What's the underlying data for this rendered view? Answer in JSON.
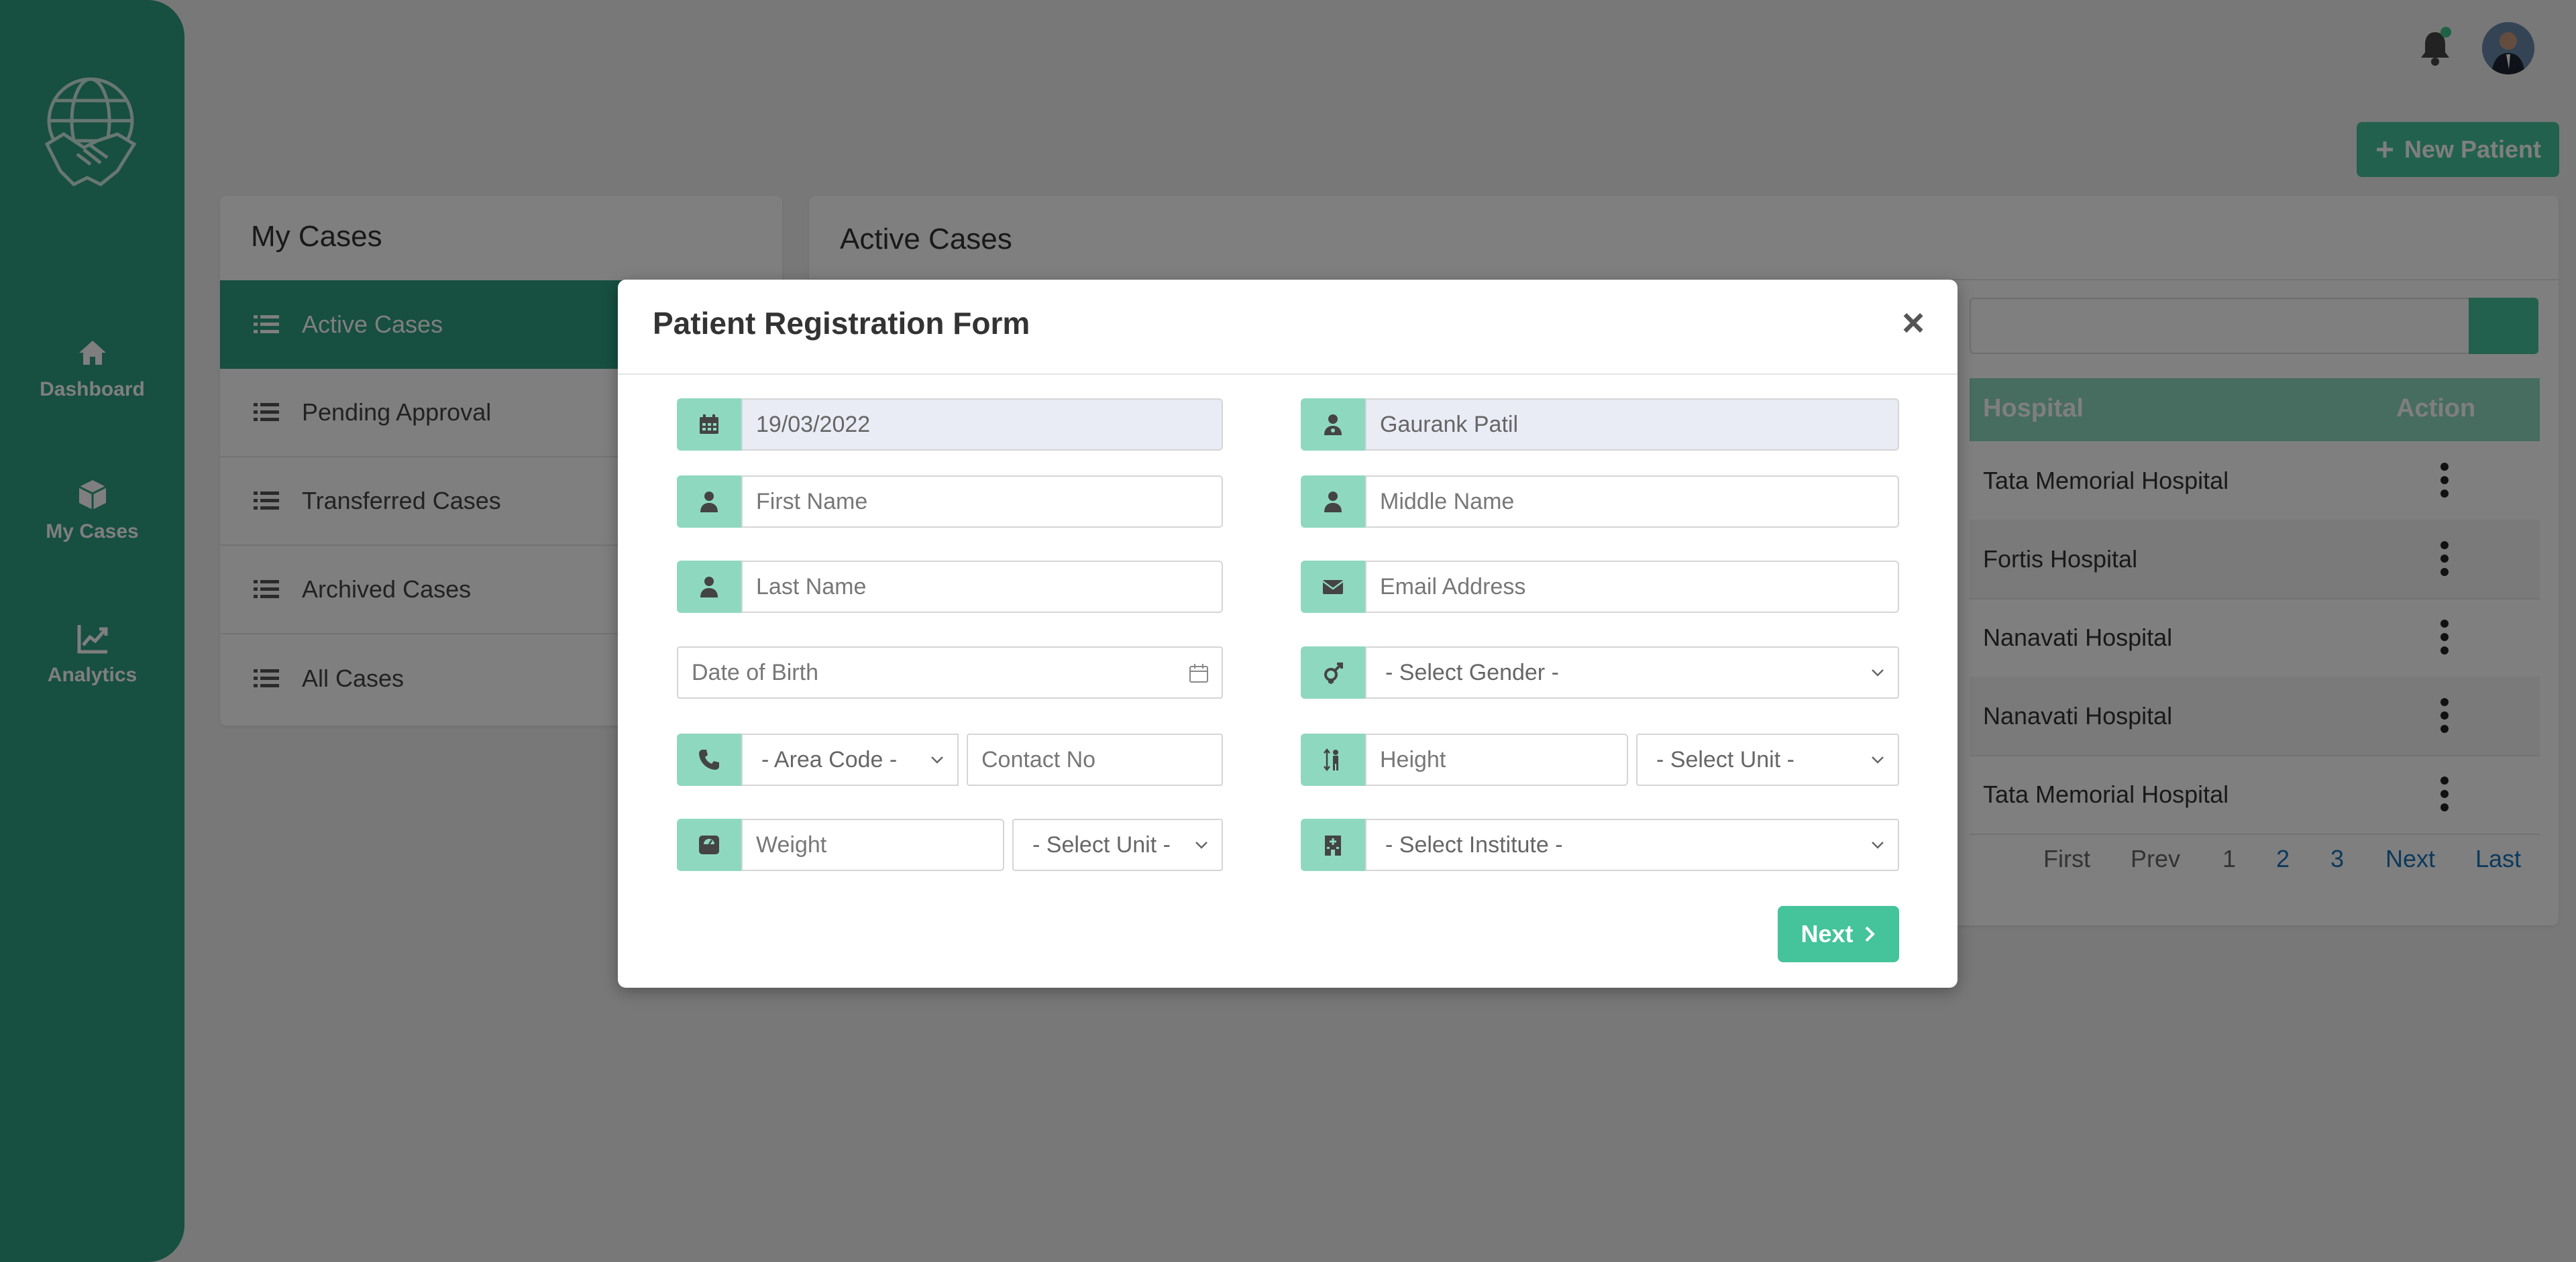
{
  "colors": {
    "brand": "#2e9e80",
    "accent": "#45c39a",
    "addon": "#8fd8c0",
    "link": "#1a73b8"
  },
  "sidebar": {
    "items": [
      {
        "label": "Dashboard",
        "icon": "home-icon"
      },
      {
        "label": "My Cases",
        "icon": "cube-icon"
      },
      {
        "label": "Analytics",
        "icon": "chart-line-icon"
      }
    ]
  },
  "header": {
    "new_patient_label": "New Patient"
  },
  "my_cases": {
    "title": "My Cases",
    "items": [
      "Active Cases",
      "Pending Approval",
      "Transferred Cases",
      "Archived Cases",
      "All Cases"
    ],
    "active_index": 0
  },
  "active_cases": {
    "title": "Active Cases",
    "columns": {
      "hospital": "Hospital",
      "action": "Action"
    },
    "rows": [
      {
        "hospital": "Tata Memorial Hospital"
      },
      {
        "hospital": "Fortis Hospital"
      },
      {
        "hospital": "Nanavati Hospital"
      },
      {
        "hospital": "Nanavati Hospital"
      },
      {
        "hospital": "Tata Memorial Hospital"
      }
    ],
    "pagination": {
      "first": "First",
      "prev": "Prev",
      "pages": [
        "1",
        "2",
        "3"
      ],
      "next": "Next",
      "last": "Last"
    }
  },
  "modal": {
    "title": "Patient Registration Form",
    "date_value": "19/03/2022",
    "doctor_value": "Gaurank Patil",
    "first_name_placeholder": "First Name",
    "middle_name_placeholder": "Middle Name",
    "last_name_placeholder": "Last Name",
    "email_placeholder": "Email Address",
    "dob_placeholder": "Date of Birth",
    "gender_select": "- Select Gender -",
    "area_code_select": "- Area Code -",
    "contact_placeholder": "Contact No",
    "height_placeholder": "Height",
    "height_unit_select": "- Select Unit -",
    "weight_placeholder": "Weight",
    "weight_unit_select": "- Select Unit -",
    "institute_select": "- Select Institute -",
    "next_label": "Next"
  }
}
